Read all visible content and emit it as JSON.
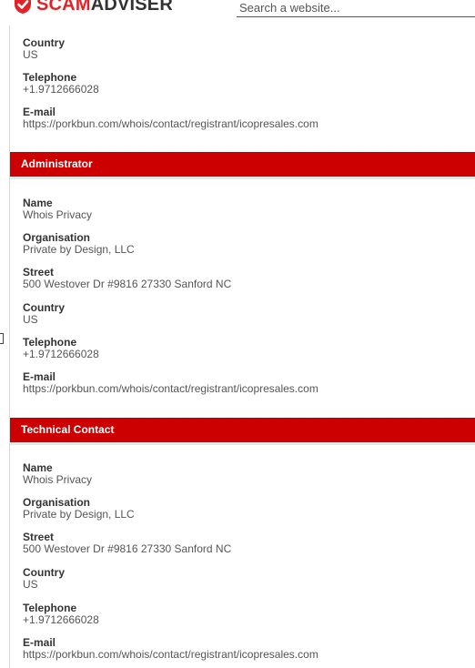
{
  "brand": {
    "scam": "SCAM",
    "adviser": "ADVISER",
    "red": "#e32227",
    "dark": "#333333"
  },
  "search": {
    "placeholder": "Search a website..."
  },
  "colors": {
    "section_header_bg": "#cc0000",
    "section_header_text": "#ffffff"
  },
  "registrant_tail": {
    "country_label": "Country",
    "country": "US",
    "telephone_label": "Telephone",
    "telephone": "+1.9712666028",
    "email_label": "E-mail",
    "email": "https://porkbun.com/whois/contact/registrant/icopresales.com"
  },
  "administrator": {
    "title": "Administrator",
    "name_label": "Name",
    "name": "Whois Privacy",
    "organisation_label": "Organisation",
    "organisation": "Private by Design, LLC",
    "street_label": "Street",
    "street": "500 Westover Dr #9816 27330 Sanford NC",
    "country_label": "Country",
    "country": "US",
    "telephone_label": "Telephone",
    "telephone": "+1.9712666028",
    "email_label": "E-mail",
    "email": "https://porkbun.com/whois/contact/registrant/icopresales.com"
  },
  "technical": {
    "title": "Technical Contact",
    "name_label": "Name",
    "name": "Whois Privacy",
    "organisation_label": "Organisation",
    "organisation": "Private by Design, LLC",
    "street_label": "Street",
    "street": "500 Westover Dr #9816 27330 Sanford NC",
    "country_label": "Country",
    "country": "US",
    "telephone_label": "Telephone",
    "telephone": "+1.9712666028",
    "email_label": "E-mail",
    "email": "https://porkbun.com/whois/contact/registrant/icopresales.com"
  }
}
